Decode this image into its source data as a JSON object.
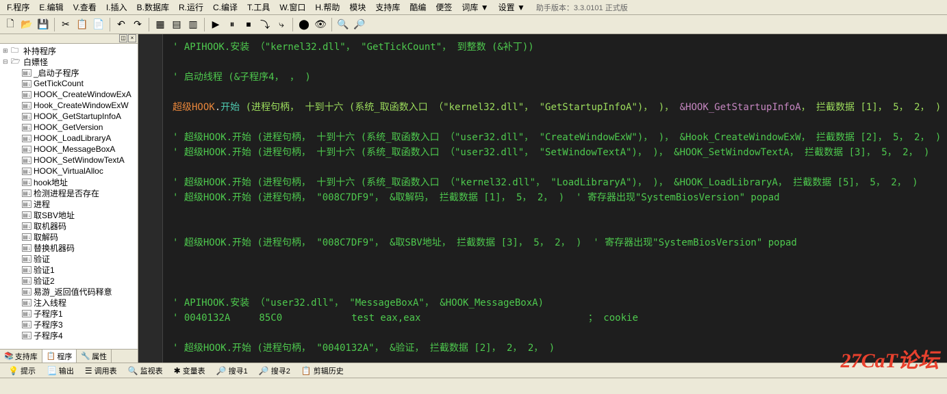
{
  "menu": {
    "items": [
      "F.程序",
      "E.编辑",
      "V.查看",
      "I.插入",
      "B.数据库",
      "R.运行",
      "C.编译",
      "T.工具",
      "W.窗口",
      "H.帮助",
      "模块",
      "支持库",
      "酷编",
      "便签",
      "词库 ▼",
      "设置 ▼"
    ],
    "version": "助手版本：3.3.0101 正式版"
  },
  "tree": {
    "root1": "补持程序",
    "root2": "白嫖怪",
    "items": [
      "_启动子程序",
      "GetTickCount",
      "HOOK_CreateWindowExA",
      "Hook_CreateWindowExW",
      "HOOK_GetStartupInfoA",
      "HOOK_GetVersion",
      "HOOK_LoadLibraryA",
      "HOOK_MessageBoxA",
      "HOOK_SetWindowTextA",
      "HOOK_VirtualAlloc",
      "hook地址",
      "检测进程是否存在",
      "进程",
      "取SBV地址",
      "取机器码",
      "取解码",
      "替换机器码",
      "验证",
      "验证1",
      "验证2",
      "易游_返回值代码释意",
      "注入线程",
      "子程序1",
      "子程序3",
      "子程序4"
    ]
  },
  "sidebar_tabs": {
    "lib": "支持库",
    "prog": "程序",
    "prop": "属性"
  },
  "code_lines": [
    {
      "type": "comment",
      "text": "' APIHOOK.安装 （\"kernel32.dll\"， \"GetTickCount\"， 到整数 (&补丁))"
    },
    {
      "type": "blank"
    },
    {
      "type": "comment",
      "text": "' 启动线程 (&子程序4， ， )"
    },
    {
      "type": "blank"
    },
    {
      "type": "call",
      "parts": [
        {
          "c": "orange",
          "t": "超级HOOK"
        },
        {
          "c": "white",
          "t": "."
        },
        {
          "c": "teal",
          "t": "开始 "
        },
        {
          "c": "olive",
          "t": "(进程句柄， 十到十六 (系统_取函数入口 （\"kernel32.dll\"， \"GetStartupInfoA\")， )， "
        },
        {
          "c": "purple",
          "t": "&HOOK_GetStartupInfoA"
        },
        {
          "c": "olive",
          "t": "， 拦截数据 [1]， 5， 2， )"
        }
      ]
    },
    {
      "type": "blank"
    },
    {
      "type": "comment",
      "text": "' 超级HOOK.开始 (进程句柄， 十到十六 (系统_取函数入口 （\"user32.dll\"， \"CreateWindowExW\")， )， &Hook_CreateWindowExW， 拦截数据 [2]， 5， 2， )"
    },
    {
      "type": "comment",
      "text": "' 超级HOOK.开始 (进程句柄， 十到十六 (系统_取函数入口 （\"user32.dll\"， \"SetWindowTextA\")， )， &HOOK_SetWindowTextA， 拦截数据 [3]， 5， 2， )"
    },
    {
      "type": "blank"
    },
    {
      "type": "comment",
      "text": "' 超级HOOK.开始 (进程句柄， 十到十六 (系统_取函数入口 （\"kernel32.dll\"， \"LoadLibraryA\")， )， &HOOK_LoadLibraryA， 拦截数据 [5]， 5， 2， )"
    },
    {
      "type": "comment",
      "text": "' 超级HOOK.开始 (进程句柄， \"008C7DF9\"， &取解码， 拦截数据 [1]， 5， 2， )  ' 寄存器出现\"SystemBiosVersion\" popad"
    },
    {
      "type": "blank"
    },
    {
      "type": "blank"
    },
    {
      "type": "comment",
      "text": "' 超级HOOK.开始 (进程句柄， \"008C7DF9\"， &取SBV地址， 拦截数据 [3]， 5， 2， )  ' 寄存器出现\"SystemBiosVersion\" popad"
    },
    {
      "type": "blank"
    },
    {
      "type": "blank"
    },
    {
      "type": "blank"
    },
    {
      "type": "comment",
      "text": "' APIHOOK.安装 （\"user32.dll\"， \"MessageBoxA\"， &HOOK_MessageBoxA)"
    },
    {
      "type": "comment",
      "text": "' 0040132A     85C0            test eax,eax                             ； cookie"
    },
    {
      "type": "blank"
    },
    {
      "type": "comment",
      "text": "' 超级HOOK.开始 (进程句柄， \"0040132A\"， &验证， 拦截数据 [2]， 2， 2， )"
    }
  ],
  "bottom_tabs": [
    "提示",
    "输出",
    "调用表",
    "监视表",
    "变量表",
    "搜寻1",
    "搜寻2",
    "剪辑历史"
  ],
  "watermark": "27CaT论坛"
}
